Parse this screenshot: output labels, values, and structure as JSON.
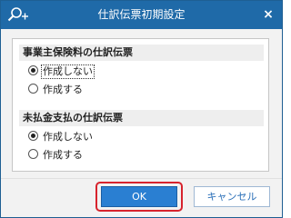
{
  "window": {
    "title": "仕訳伝票初期設定",
    "close_glyph": "×"
  },
  "icons": {
    "title_icon": "search-plus-icon",
    "close_icon": "close-icon"
  },
  "sections": [
    {
      "title": "事業主保険料の仕訳伝票",
      "options": [
        {
          "label": "作成しない",
          "selected": true
        },
        {
          "label": "作成する",
          "selected": false
        }
      ]
    },
    {
      "title": "未払金支払の仕訳伝票",
      "options": [
        {
          "label": "作成しない",
          "selected": true
        },
        {
          "label": "作成する",
          "selected": false
        }
      ]
    }
  ],
  "buttons": {
    "ok_label": "OK",
    "cancel_label": "キャンセル"
  },
  "colors": {
    "titlebar": "#1f6aa8",
    "ok_button": "#2a7fd2",
    "highlight": "#d7232d"
  }
}
